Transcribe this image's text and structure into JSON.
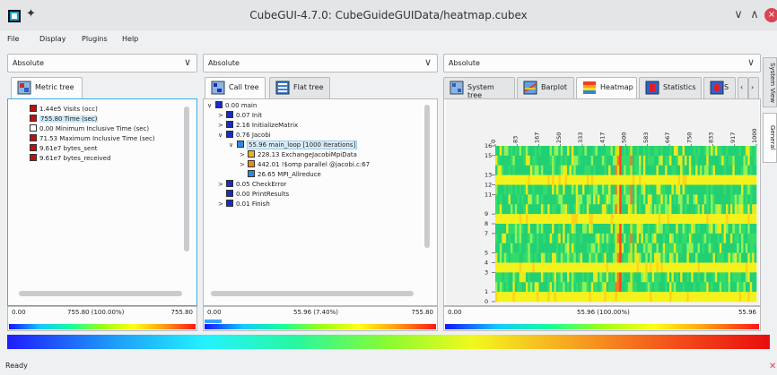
{
  "window": {
    "title": "CubeGUI-4.7.0: CubeGuideGUIData/heatmap.cubex",
    "minimize_icon": "chevron-down-icon",
    "maximize_icon": "chevron-up-icon",
    "close_glyph": "×"
  },
  "menu": [
    "File",
    "Display",
    "Plugins",
    "Help"
  ],
  "metric_panel": {
    "combo_value": "Absolute",
    "tab_label": "Metric tree",
    "items": [
      {
        "value": "1.44e5",
        "label": "Visits (occ)",
        "color": "#c01010"
      },
      {
        "value": "755.80",
        "label": "Time (sec)",
        "color": "#c01010",
        "selected": true
      },
      {
        "value": "0.00",
        "label": "Minimum Inclusive Time (sec)",
        "color": "#ffffff"
      },
      {
        "value": "71.53",
        "label": "Maximum Inclusive Time (sec)",
        "color": "#c01010"
      },
      {
        "value": "9.61e7",
        "label": "bytes_sent",
        "color": "#c01010"
      },
      {
        "value": "9.61e7",
        "label": "bytes_received",
        "color": "#c01010"
      }
    ],
    "value_left": "0.00",
    "value_mid": "755.80 (100.00%)",
    "value_right": "755.80"
  },
  "call_panel": {
    "combo_value": "Absolute",
    "tab_active": "Call tree",
    "tab_other": "Flat tree",
    "items": [
      {
        "indent": 0,
        "exp": "∨",
        "value": "0.00",
        "label": "main",
        "color": "#1a2cc8"
      },
      {
        "indent": 1,
        "exp": ">",
        "value": "0.07",
        "label": "Init",
        "color": "#1a2cc8"
      },
      {
        "indent": 1,
        "exp": ">",
        "value": "2.16",
        "label": "InitializeMatrix",
        "color": "#1a2cc8"
      },
      {
        "indent": 1,
        "exp": "∨",
        "value": "0.76",
        "label": "Jacobi",
        "color": "#1a2cc8"
      },
      {
        "indent": 2,
        "exp": "∨",
        "value": "55.96",
        "label": "main_loop [1000 iterations]",
        "color": "#2a8ae0",
        "selected": true
      },
      {
        "indent": 3,
        "exp": ">",
        "value": "228.13",
        "label": "ExchangeJacobiMpiData",
        "color": "#f0b020"
      },
      {
        "indent": 3,
        "exp": ">",
        "value": "442.01",
        "label": "!$omp parallel @jacobi.c:67",
        "color": "#e88a18"
      },
      {
        "indent": 3,
        "exp": "",
        "value": "26.65",
        "label": "MPI_Allreduce",
        "color": "#2a8ae0"
      },
      {
        "indent": 1,
        "exp": ">",
        "value": "0.05",
        "label": "CheckError",
        "color": "#1a2cc8"
      },
      {
        "indent": 1,
        "exp": "",
        "value": "0.00",
        "label": "PrintResults",
        "color": "#1a2cc8"
      },
      {
        "indent": 1,
        "exp": ">",
        "value": "0.01",
        "label": "Finish",
        "color": "#1a2cc8"
      }
    ],
    "value_left": "0.00",
    "value_mid": "55.96 (7.40%)",
    "value_right": "755.80"
  },
  "system_panel": {
    "combo_value": "Absolute",
    "tabs": [
      "System tree",
      "Barplot",
      "Heatmap",
      "Statistics",
      "S"
    ],
    "active_tab": "Heatmap",
    "heatmap": {
      "x_ticks": [
        "0",
        "83",
        "167",
        "250",
        "333",
        "417",
        "500",
        "583",
        "667",
        "750",
        "833",
        "917",
        "1000"
      ],
      "y_ticks": [
        "0",
        "1",
        "3",
        "4",
        "5",
        "7",
        "8",
        "9",
        "11",
        "12",
        "13",
        "15",
        "16"
      ],
      "rows": 16,
      "cols": 1000
    },
    "value_left": "0.00",
    "value_mid": "55.96 (100.00%)",
    "value_right": "55.96"
  },
  "side_tabs": [
    "System View",
    "General"
  ],
  "status": {
    "text": "Ready"
  }
}
